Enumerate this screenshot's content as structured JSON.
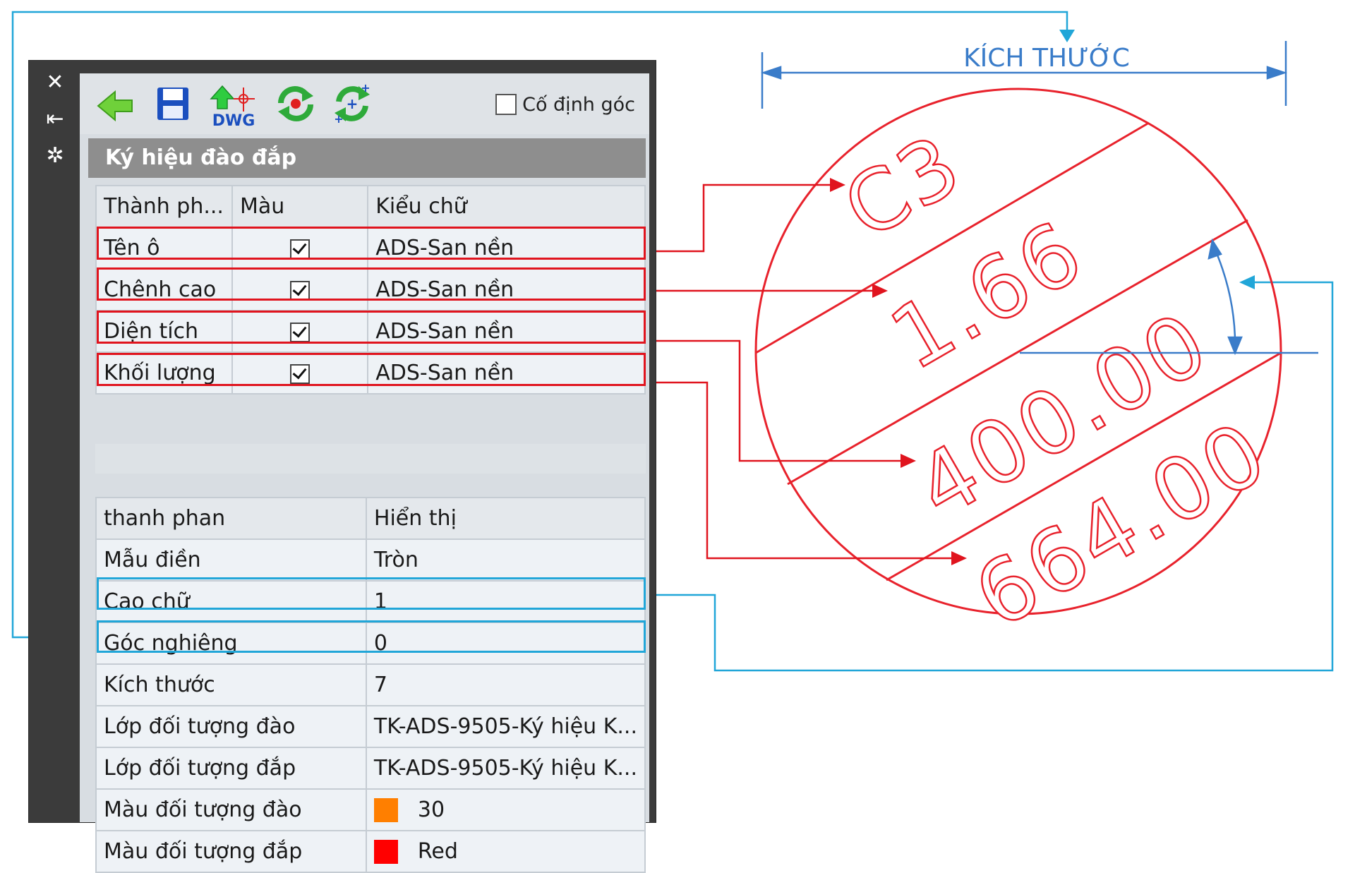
{
  "palette": {
    "side_buttons": [
      {
        "icon": "close-icon",
        "glyph": "✕"
      },
      {
        "icon": "pin-icon",
        "glyph": "⇤"
      },
      {
        "icon": "properties-icon",
        "glyph": "✲"
      }
    ],
    "toolbar": {
      "dwg_label": "DWG",
      "fixed_angle_label": "Cố định góc",
      "fixed_angle_checked": false
    },
    "section_title": "Ký hiệu đào đắp",
    "components": {
      "headers": [
        "Thành ph...",
        "Màu",
        "Kiểu chữ"
      ],
      "rows": [
        {
          "name": "Tên ô",
          "checked": true,
          "style": "ADS-San nền"
        },
        {
          "name": "Chênh cao",
          "checked": true,
          "style": "ADS-San nền"
        },
        {
          "name": "Diện tích",
          "checked": true,
          "style": "ADS-San nền"
        },
        {
          "name": "Khối lượng",
          "checked": true,
          "style": "ADS-San nền"
        }
      ]
    },
    "properties": {
      "headers": [
        "thanh phan",
        "Hiển thị"
      ],
      "rows": [
        {
          "name": "Mẫu điền",
          "value": "Tròn"
        },
        {
          "name": "Cao chữ",
          "value": "1"
        },
        {
          "name": "Góc nghiêng",
          "value": "0"
        },
        {
          "name": "Kích thước",
          "value": "7"
        },
        {
          "name": "Lớp đối tượng đào",
          "value": "TK-ADS-9505-Ký hiệu K..."
        },
        {
          "name": "Lớp đối tượng đắp",
          "value": "TK-ADS-9505-Ký hiệu K..."
        },
        {
          "name": "Màu đối tượng đào",
          "value": "30",
          "swatch": "#ff7f00"
        },
        {
          "name": "Màu đối tượng đắp",
          "value": "Red",
          "swatch": "#ff0000"
        }
      ]
    }
  },
  "symbol": {
    "dimension_label": "KÍCH THƯỚC",
    "texts": [
      "C3",
      "1.66",
      "400.00",
      "664.00"
    ],
    "stroke_color": "#e8222c"
  },
  "colors": {
    "red_callout": "#e0141e",
    "blue_callout": "#21a6d8",
    "dimension_blue": "#3a7cc9"
  }
}
